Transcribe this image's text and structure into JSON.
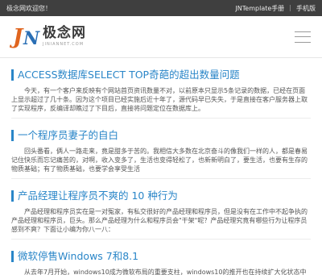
{
  "topbar": {
    "welcome": "极念网欢迎您！",
    "links": [
      "JNTemplate手册",
      "|",
      "手机版"
    ]
  },
  "header": {
    "logo_mark_j": "J",
    "logo_mark_n": "N",
    "logo_name": "极念网",
    "logo_domain": "JINIANNET.COM",
    "menu_icon": "hamburger-icon"
  },
  "articles": [
    {
      "title": "ACCESS数据库SELECT TOP奇葩的超出数量问题",
      "summary": "今天，有一个客户来反映有个网站首页资讯数量不对，以前原本只显示5条记录的数据，已经在页面上显示超过了几十条。因为这个项目已经实施后近十年了，源代码早已失失，于是直接在客户服务器上取了实现程序，反编译却瞧过了下目后，直接将问题定位在数据库上。"
    },
    {
      "title": "一个程序员妻子的自白",
      "summary": "回头番看，俩人一路走来，竟是甜多于苦的。我相信大多数在北京奋斗的像我们一样的人，都是春易记住快乐而忘记痛苦的，对啊，收入变多了，生活也变得轻松了，也新新明白了，要生活，也要有生存的物质基础；有了物质基础，也要学会享受生活"
    },
    {
      "title": "产品经理让程序员不爽的 10 种行为",
      "summary": "产品经理和程序员实在是一对冤家，有私交很好的产品经理和程序员，但是没有在工作中不起争执的产品经理和程序员，巨头。那么产品经理为什么和程序员会\"干架\"呢？产品经理究竟有哪些行为让程序员感到不爽？下面让小编为你八一八："
    },
    {
      "title": "微软停售Windows 7和8.1",
      "summary": "从去年7月开始，windows10成为微软布局的重要支柱，windows10的推开也在持续扩大化状态中"
    }
  ]
}
